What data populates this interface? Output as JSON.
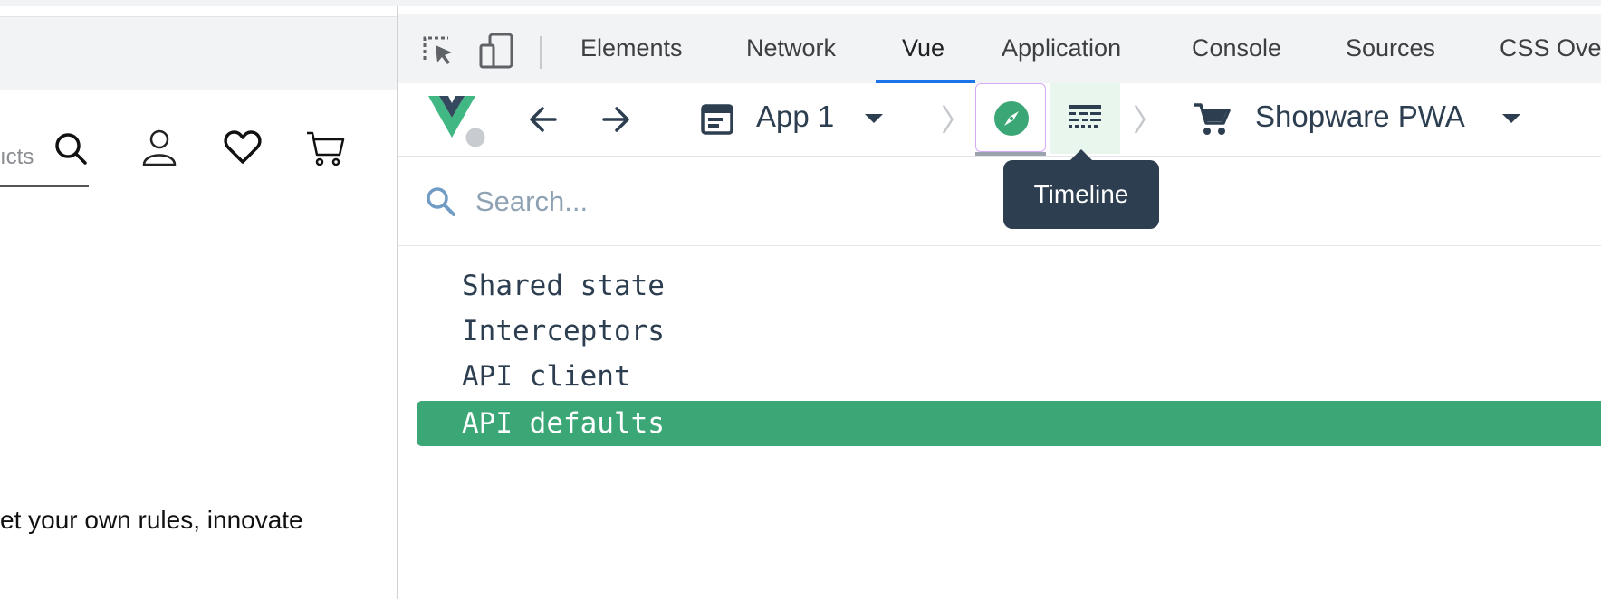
{
  "page": {
    "search_fragment": "ıcts",
    "body_text": "et your own rules, innovate"
  },
  "devtools": {
    "tabs": [
      {
        "label": "Elements"
      },
      {
        "label": "Network"
      },
      {
        "label": "Vue",
        "active": true
      },
      {
        "label": "Application"
      },
      {
        "label": "Console"
      },
      {
        "label": "Sources"
      },
      {
        "label": "CSS Ove"
      }
    ],
    "accent": "#1a73e8"
  },
  "vue": {
    "app_selector": "App 1",
    "plugin_selector": "Shopware PWA",
    "search_placeholder": "Search...",
    "tooltip": "Timeline",
    "brand_color": "#3ba776",
    "items": [
      {
        "label": "Shared state"
      },
      {
        "label": "Interceptors"
      },
      {
        "label": "API client"
      },
      {
        "label": "API defaults",
        "selected": true
      }
    ]
  }
}
